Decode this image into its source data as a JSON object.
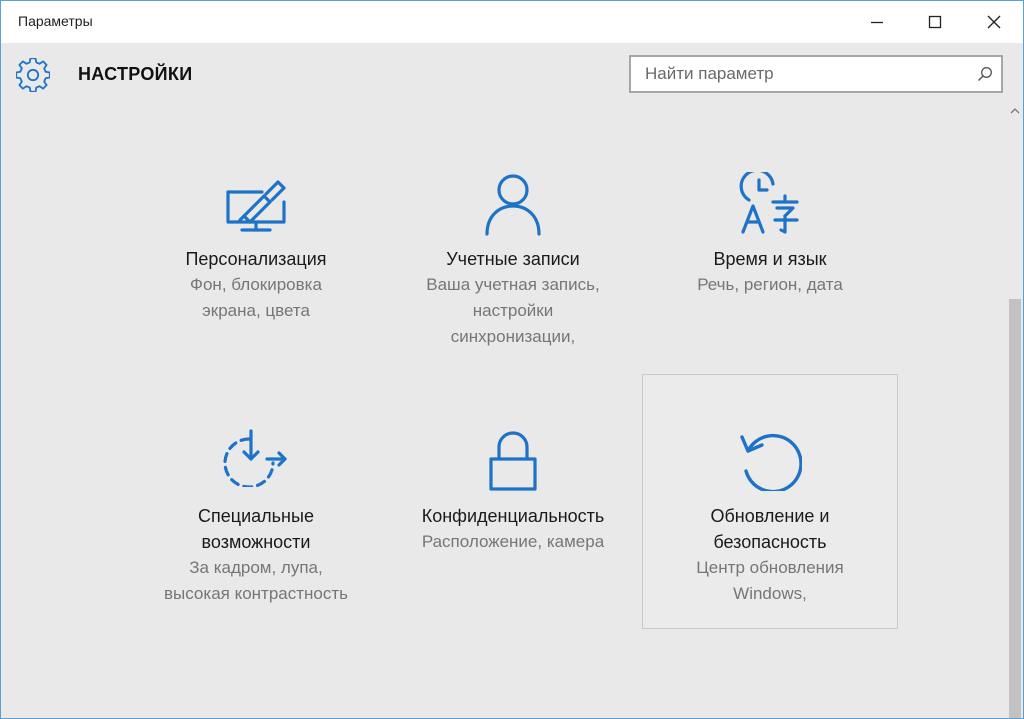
{
  "window": {
    "title": "Параметры",
    "controls": [
      "minimize-icon",
      "maximize-icon",
      "close-icon"
    ]
  },
  "header": {
    "title": "НАСТРОЙКИ",
    "icon": "gear-icon"
  },
  "search": {
    "placeholder": "Найти параметр",
    "value": "",
    "icon": "search-icon"
  },
  "accent_color": "#1e73c8",
  "tiles": [
    {
      "name": "personalization",
      "icon": "monitor-brush-icon",
      "title": [
        "Персонализация"
      ],
      "desc": [
        "Фон, блокировка",
        "экрана, цвета"
      ]
    },
    {
      "name": "accounts",
      "icon": "person-icon",
      "title": [
        "Учетные записи"
      ],
      "desc": [
        "Ваша учетная запись,",
        "настройки",
        "синхронизации,"
      ]
    },
    {
      "name": "time-language",
      "icon": "clock-language-icon",
      "title": [
        "Время и язык"
      ],
      "desc": [
        "Речь, регион, дата"
      ]
    },
    {
      "name": "ease-of-access",
      "icon": "ease-of-access-icon",
      "title": [
        "Специальные",
        "возможности"
      ],
      "desc": [
        "За кадром, лупа,",
        "высокая контрастность"
      ]
    },
    {
      "name": "privacy",
      "icon": "lock-icon",
      "title": [
        "Конфиденциальность"
      ],
      "desc": [
        "Расположение, камера"
      ]
    },
    {
      "name": "update-security",
      "icon": "refresh-icon",
      "title": [
        "Обновление и",
        "безопасность"
      ],
      "desc": [
        "Центр обновления",
        "Windows,"
      ]
    }
  ]
}
